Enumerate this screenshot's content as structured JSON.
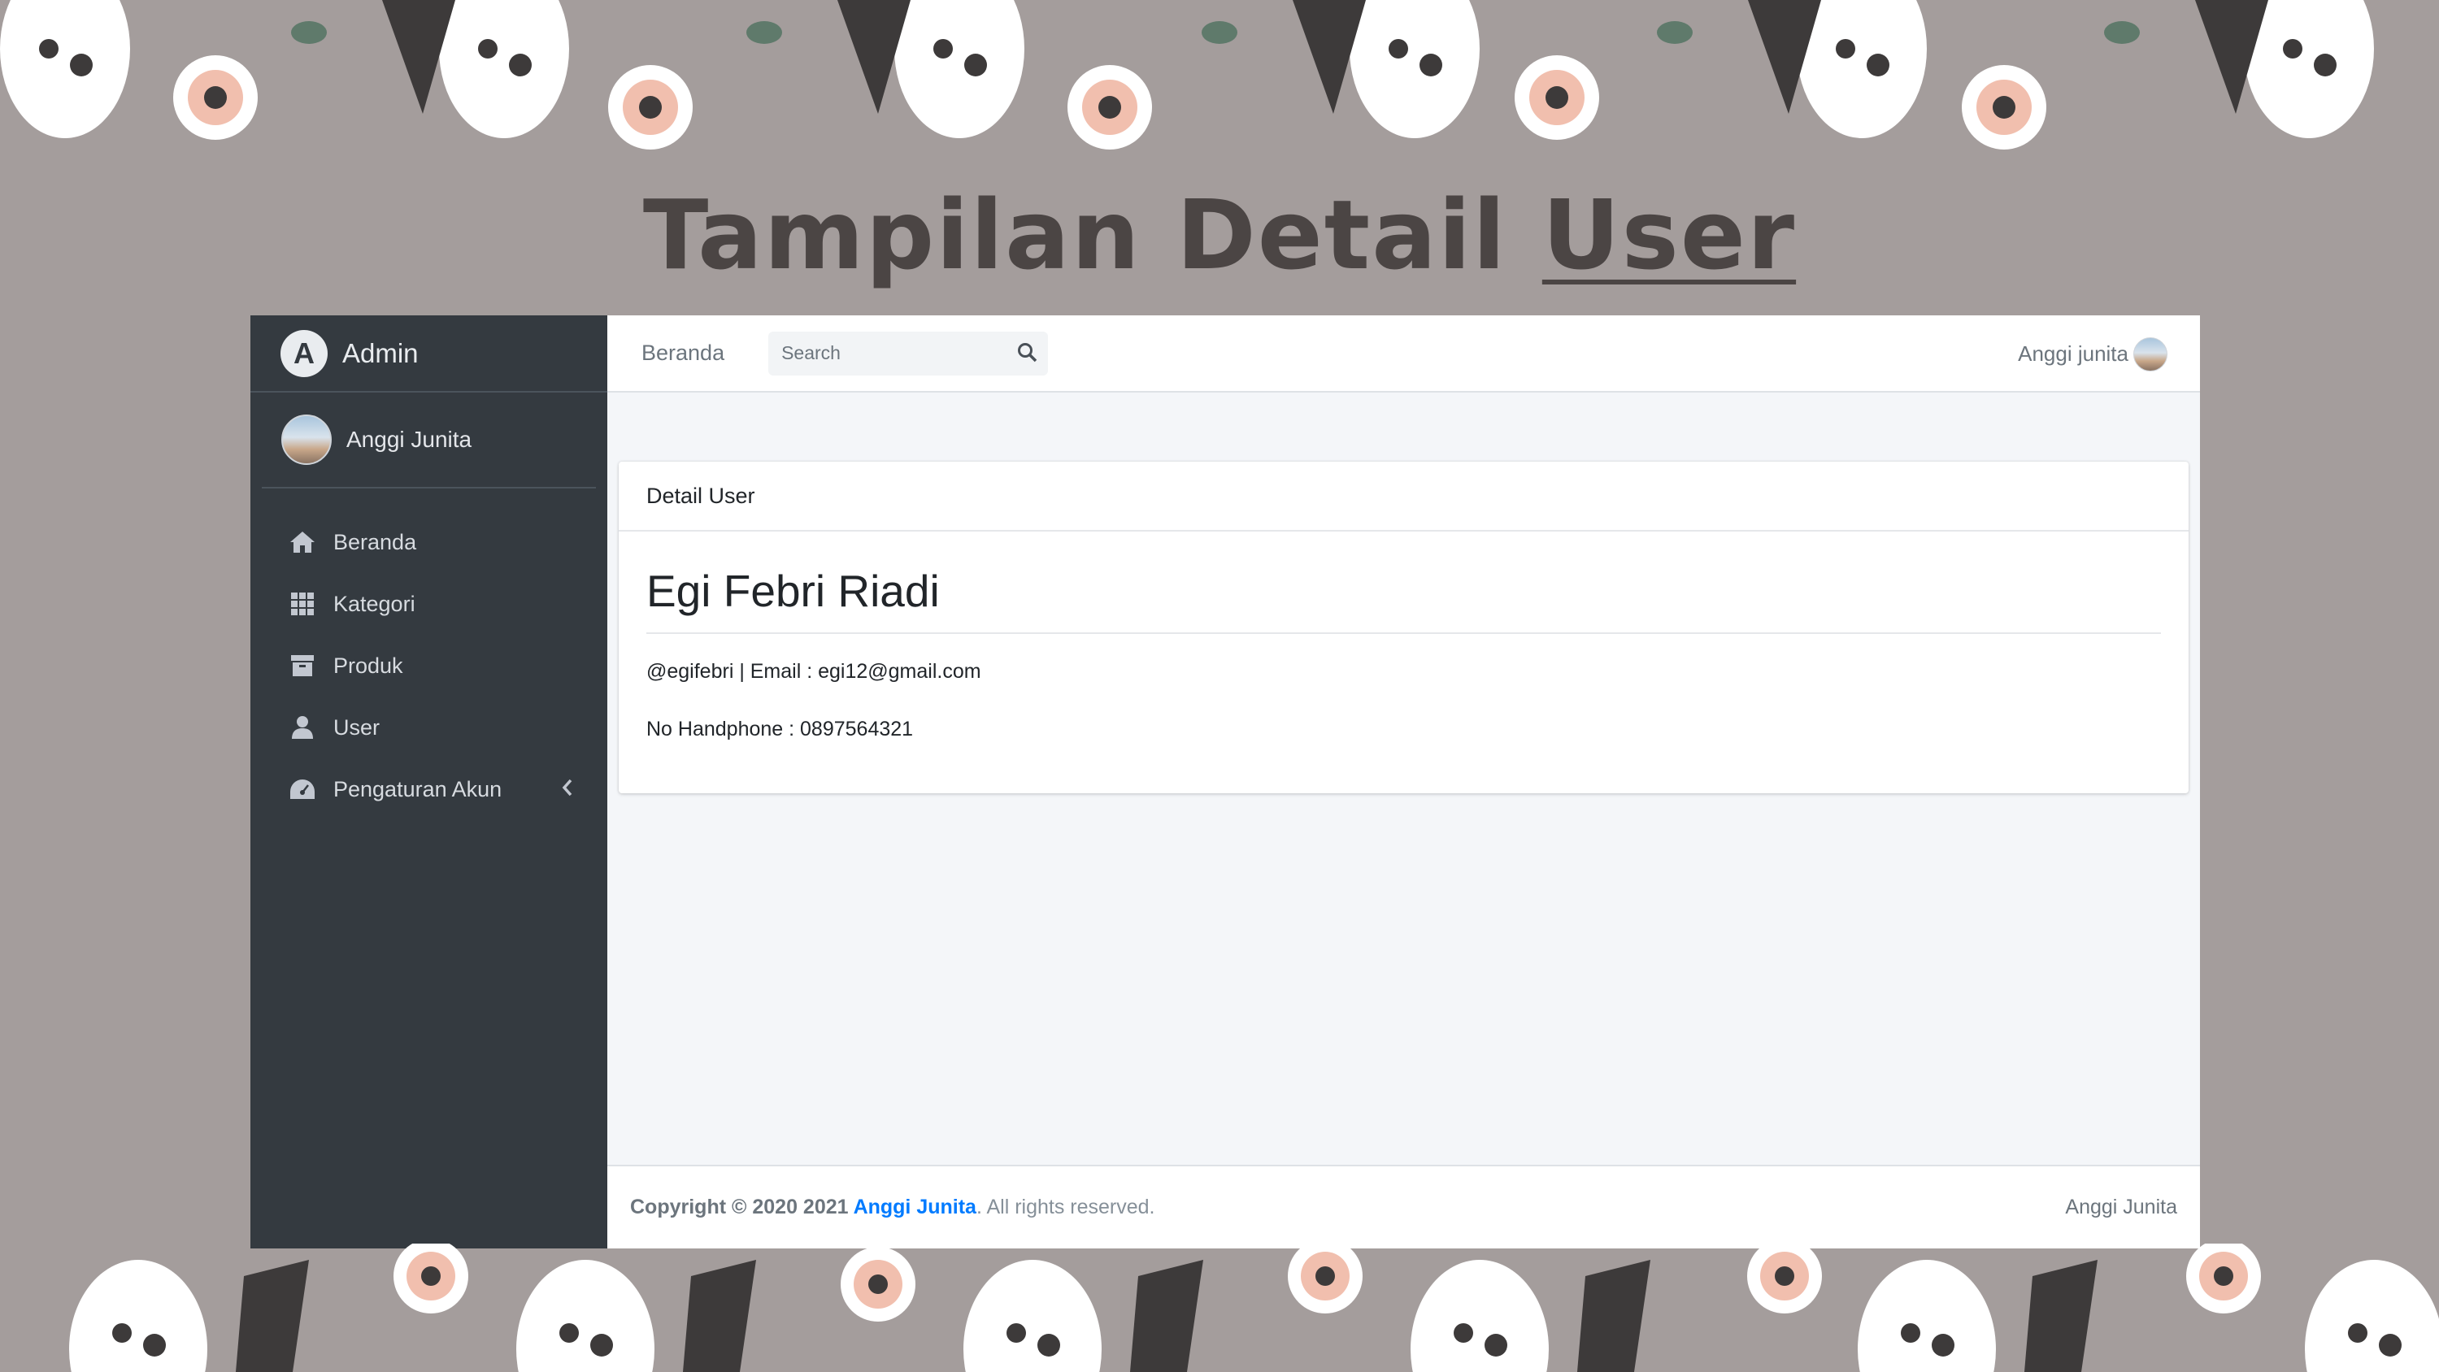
{
  "slide": {
    "title_prefix": "Tampilan Detail ",
    "title_emphasis": "User"
  },
  "sidebar": {
    "brand": "Admin",
    "brand_logo_letter": "A",
    "user_name": "Anggi Junita",
    "items": [
      {
        "label": "Beranda",
        "icon": "home-icon"
      },
      {
        "label": "Kategori",
        "icon": "grid-icon"
      },
      {
        "label": "Produk",
        "icon": "archive-icon"
      },
      {
        "label": "User",
        "icon": "user-icon"
      },
      {
        "label": "Pengaturan Akun",
        "icon": "dashboard-gauge-icon"
      }
    ]
  },
  "topbar": {
    "home_link": "Beranda",
    "search_placeholder": "Search",
    "user_label": "Anggi junita"
  },
  "card": {
    "header": "Detail User",
    "name": "Egi Febri Riadi",
    "line1": "@egifebri | Email : egi12@gmail.com",
    "line2": "No Handphone : 0897564321"
  },
  "footer": {
    "copyright_prefix": "Copyright © 2020 2021 ",
    "author_link": "Anggi Junita",
    "suffix": ". All rights reserved.",
    "right_text": "Anggi Junita"
  },
  "colors": {
    "slide_bg": "#a49d9c",
    "sidebar_bg": "#343a40",
    "content_bg": "#f4f6f9",
    "link": "#007bff"
  }
}
